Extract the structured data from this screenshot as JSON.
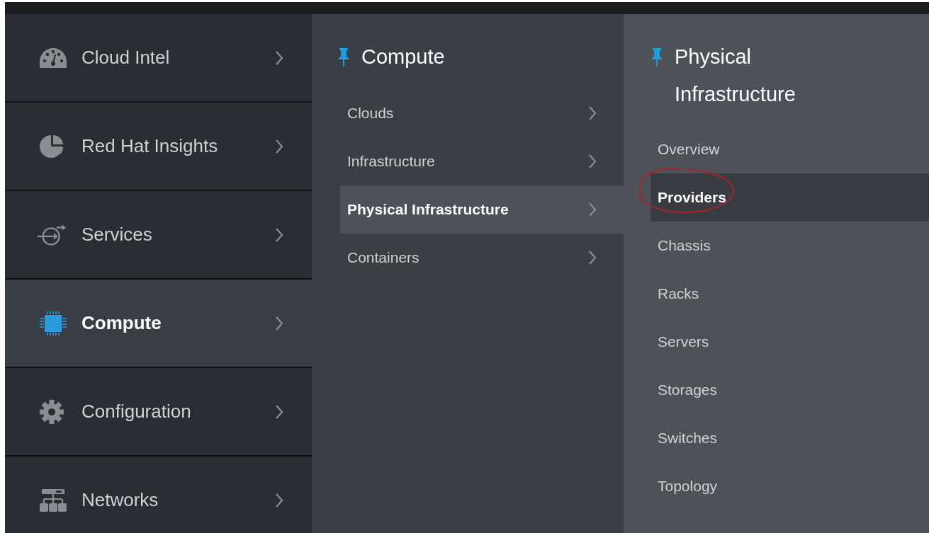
{
  "main_menu": [
    {
      "label": "Cloud Intel",
      "selected": false
    },
    {
      "label": "Red Hat Insights",
      "selected": false
    },
    {
      "label": "Services",
      "selected": false
    },
    {
      "label": "Compute",
      "selected": true
    },
    {
      "label": "Configuration",
      "selected": false
    },
    {
      "label": "Networks",
      "selected": false
    }
  ],
  "submenu": {
    "title": "Compute",
    "items": [
      {
        "label": "Clouds",
        "selected": false
      },
      {
        "label": "Infrastructure",
        "selected": false
      },
      {
        "label": "Physical Infrastructure",
        "selected": true
      },
      {
        "label": "Containers",
        "selected": false
      }
    ]
  },
  "subsubmenu": {
    "title": "Physical Infrastructure",
    "items": [
      {
        "label": "Overview",
        "selected": false
      },
      {
        "label": "Providers",
        "selected": true
      },
      {
        "label": "Chassis",
        "selected": false
      },
      {
        "label": "Racks",
        "selected": false
      },
      {
        "label": "Servers",
        "selected": false
      },
      {
        "label": "Storages",
        "selected": false
      },
      {
        "label": "Switches",
        "selected": false
      },
      {
        "label": "Topology",
        "selected": false
      }
    ]
  }
}
